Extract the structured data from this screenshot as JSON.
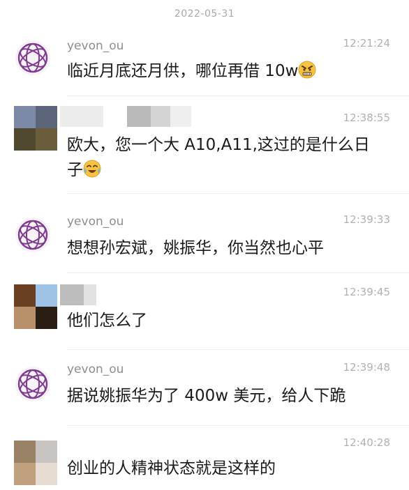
{
  "chat": {
    "date": "2022-05-31",
    "messages": [
      {
        "sender": "yevon_ou",
        "time": "12:21:24",
        "text": "临近月底还月供，哪位再借 10w",
        "emoji": "angry-face-emoji"
      },
      {
        "sender": "",
        "time": "12:38:55",
        "text_line1": "欧大，您一个大 A10,A11,这过的是什么日",
        "text_line2": "子",
        "emoji": "crying-laughing-face-emoji"
      },
      {
        "sender": "yevon_ou",
        "time": "12:39:33",
        "text": "想想孙宏斌，姚振华，你当然也心平"
      },
      {
        "sender": "",
        "time": "12:39:45",
        "text": "他们怎么了"
      },
      {
        "sender": "yevon_ou",
        "time": "12:39:48",
        "text": "据说姚振华为了 400w 美元，给人下跪"
      },
      {
        "sender": "",
        "time": "12:40:28",
        "text": "创业的人精神状态就是这样的"
      }
    ]
  },
  "colors": {
    "logo_purple": "#7e3a8e",
    "name_gray": "#8d8d8d",
    "time_gray": "#b0b0b0"
  }
}
